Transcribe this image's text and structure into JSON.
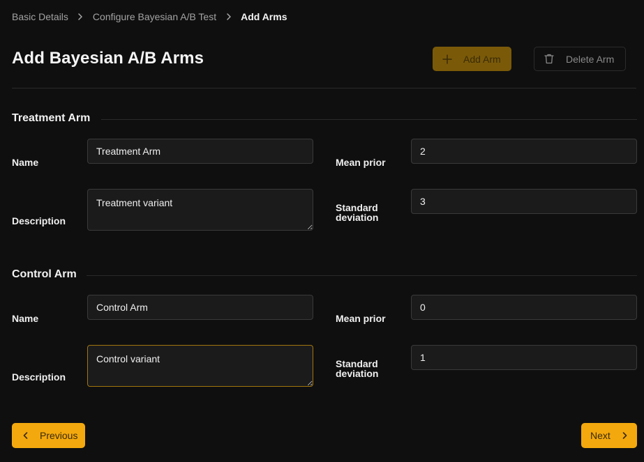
{
  "breadcrumb": {
    "items": [
      "Basic Details",
      "Configure Bayesian A/B Test",
      "Add Arms"
    ]
  },
  "header": {
    "title": "Add Bayesian A/B Arms",
    "add_label": "Add Arm",
    "delete_label": "Delete Arm"
  },
  "arms": [
    {
      "title": "Treatment Arm",
      "name_label": "Name",
      "name_value": "Treatment Arm",
      "description_label": "Description",
      "description_value": "Treatment variant",
      "mean_prior_label": "Mean prior",
      "mean_prior_value": "2",
      "std_label_line1": "Standard",
      "std_label_line2": "deviation",
      "std_value": "3"
    },
    {
      "title": "Control Arm",
      "name_label": "Name",
      "name_value": "Control Arm",
      "description_label": "Description",
      "description_value": "Control variant",
      "mean_prior_label": "Mean prior",
      "mean_prior_value": "0",
      "std_label_line1": "Standard",
      "std_label_line2": "deviation",
      "std_value": "1"
    }
  ],
  "footer": {
    "previous_label": "Previous",
    "next_label": "Next"
  },
  "colors": {
    "accent": "#f3a80e",
    "accent_disabled": "#7a5a09",
    "background": "#0f0f0f",
    "focus_border": "#a3770e"
  },
  "icons": {
    "breadcrumb_separator": "chevron-right-icon",
    "add": "plus-icon",
    "delete": "trash-icon",
    "previous": "chevron-left-icon",
    "next": "chevron-right-icon"
  }
}
